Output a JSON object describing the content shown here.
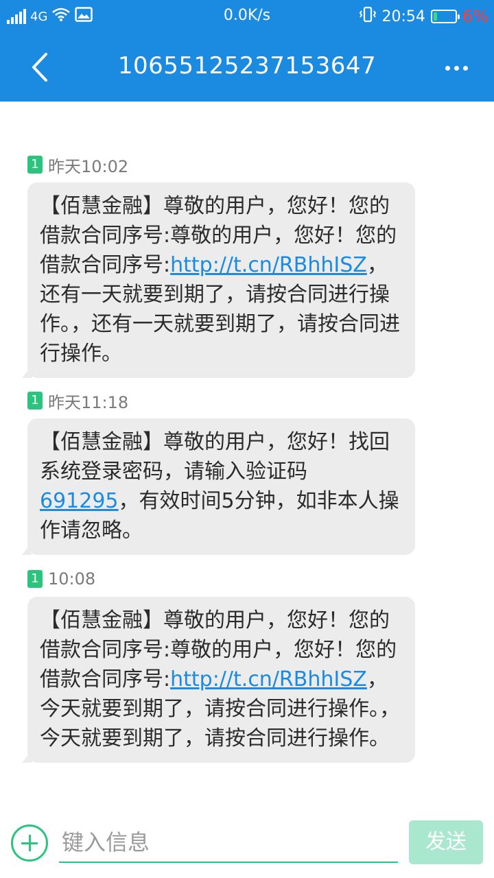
{
  "status_bar": {
    "network": "4G",
    "speed": "0.0K/s",
    "time": "20:54",
    "battery_percent": "6%",
    "battery_level": 0.06,
    "icons": [
      "signal-icon",
      "wifi-icon",
      "image-notification-icon",
      "vibrate-icon",
      "battery-icon"
    ]
  },
  "header": {
    "title": "10655125237153647",
    "back_icon": "chevron-left-icon",
    "more_icon": "more-dots-icon"
  },
  "colors": {
    "accent": "#1a8be0",
    "sim_badge": "#2bc47e",
    "bubble": "#ececec",
    "link": "#1a8be0",
    "battery_pct": "#ff3b3b"
  },
  "messages": [
    {
      "sim": "1",
      "time": "昨天10:02",
      "parts": [
        {
          "text": "【佰慧金融】尊敬的用户，您好！您的借款合同序号:尊敬的用户，您好！您的借款合同序号:",
          "link": false
        },
        {
          "text": "http://t.cn/RBhhISZ",
          "link": true
        },
        {
          "text": "，还有一天就要到期了，请按合同进行操作。，还有一天就要到期了，请按合同进行操作。",
          "link": false
        }
      ]
    },
    {
      "sim": "1",
      "time": "昨天11:18",
      "parts": [
        {
          "text": "【佰慧金融】尊敬的用户，您好！找回系统登录密码，请输入验证码",
          "link": false
        },
        {
          "text": "691295",
          "link": true
        },
        {
          "text": "，有效时间5分钟，如非本人操作请忽略。",
          "link": false
        }
      ]
    },
    {
      "sim": "1",
      "time": "10:08",
      "parts": [
        {
          "text": "【佰慧金融】尊敬的用户，您好！您的借款合同序号:尊敬的用户，您好！您的借款合同序号:",
          "link": false
        },
        {
          "text": "http://t.cn/RBhhISZ",
          "link": true
        },
        {
          "text": "，今天就要到期了，请按合同进行操作。，今天就要到期了，请按合同进行操作。",
          "link": false
        }
      ]
    }
  ],
  "composer": {
    "add_icon": "plus-circle-icon",
    "placeholder": "键入信息",
    "value": "",
    "send_label": "发送"
  }
}
